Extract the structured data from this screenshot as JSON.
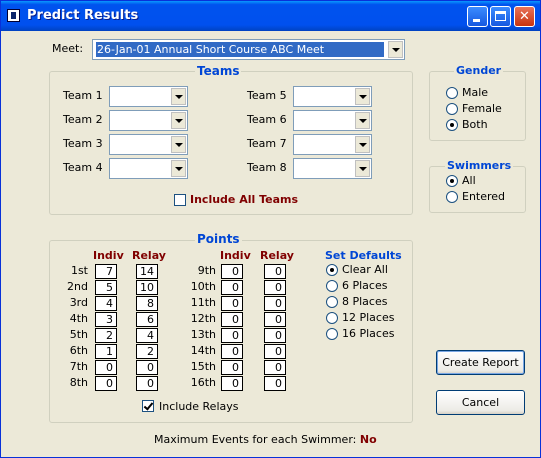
{
  "window": {
    "title": "Predict Results"
  },
  "meet": {
    "label": "Meet:",
    "value": "26-Jan-01 Annual Short Course ABC Meet"
  },
  "teams": {
    "title": "Teams",
    "labels": [
      "Team 1",
      "Team 2",
      "Team 3",
      "Team 4",
      "Team 5",
      "Team 6",
      "Team 7",
      "Team 8"
    ],
    "include_all_label": "Include All Teams",
    "include_all_checked": false
  },
  "gender": {
    "title": "Gender",
    "options": [
      "Male",
      "Female",
      "Both"
    ],
    "selected": "Both"
  },
  "swimmers": {
    "title": "Swimmers",
    "options": [
      "All",
      "Entered"
    ],
    "selected": "All"
  },
  "points": {
    "title": "Points",
    "indiv_header": "Indiv",
    "relay_header": "Relay",
    "left_places": [
      {
        "place": "1st",
        "indiv": "7",
        "relay": "14"
      },
      {
        "place": "2nd",
        "indiv": "5",
        "relay": "10"
      },
      {
        "place": "3rd",
        "indiv": "4",
        "relay": "8"
      },
      {
        "place": "4th",
        "indiv": "3",
        "relay": "6"
      },
      {
        "place": "5th",
        "indiv": "2",
        "relay": "4"
      },
      {
        "place": "6th",
        "indiv": "1",
        "relay": "2"
      },
      {
        "place": "7th",
        "indiv": "0",
        "relay": "0"
      },
      {
        "place": "8th",
        "indiv": "0",
        "relay": "0"
      }
    ],
    "right_places": [
      {
        "place": "9th",
        "indiv": "0",
        "relay": "0"
      },
      {
        "place": "10th",
        "indiv": "0",
        "relay": "0"
      },
      {
        "place": "11th",
        "indiv": "0",
        "relay": "0"
      },
      {
        "place": "12th",
        "indiv": "0",
        "relay": "0"
      },
      {
        "place": "13th",
        "indiv": "0",
        "relay": "0"
      },
      {
        "place": "14th",
        "indiv": "0",
        "relay": "0"
      },
      {
        "place": "15th",
        "indiv": "0",
        "relay": "0"
      },
      {
        "place": "16th",
        "indiv": "0",
        "relay": "0"
      }
    ],
    "set_defaults_title": "Set Defaults",
    "defaults": [
      "Clear All",
      "6 Places",
      "8 Places",
      "12 Places",
      "16 Places"
    ],
    "defaults_selected": "Clear All",
    "include_relays_label": "Include Relays",
    "include_relays_checked": true
  },
  "footer": {
    "max_events_label": "Maximum Events for each Swimmer:",
    "max_events_value": "No"
  },
  "buttons": {
    "create_report": "Create Report",
    "cancel": "Cancel"
  },
  "colors": {
    "title_bar": "#0054e3",
    "group_title": "#0046d5",
    "header_maroon": "#800000",
    "window_bg": "#ece9d8"
  }
}
